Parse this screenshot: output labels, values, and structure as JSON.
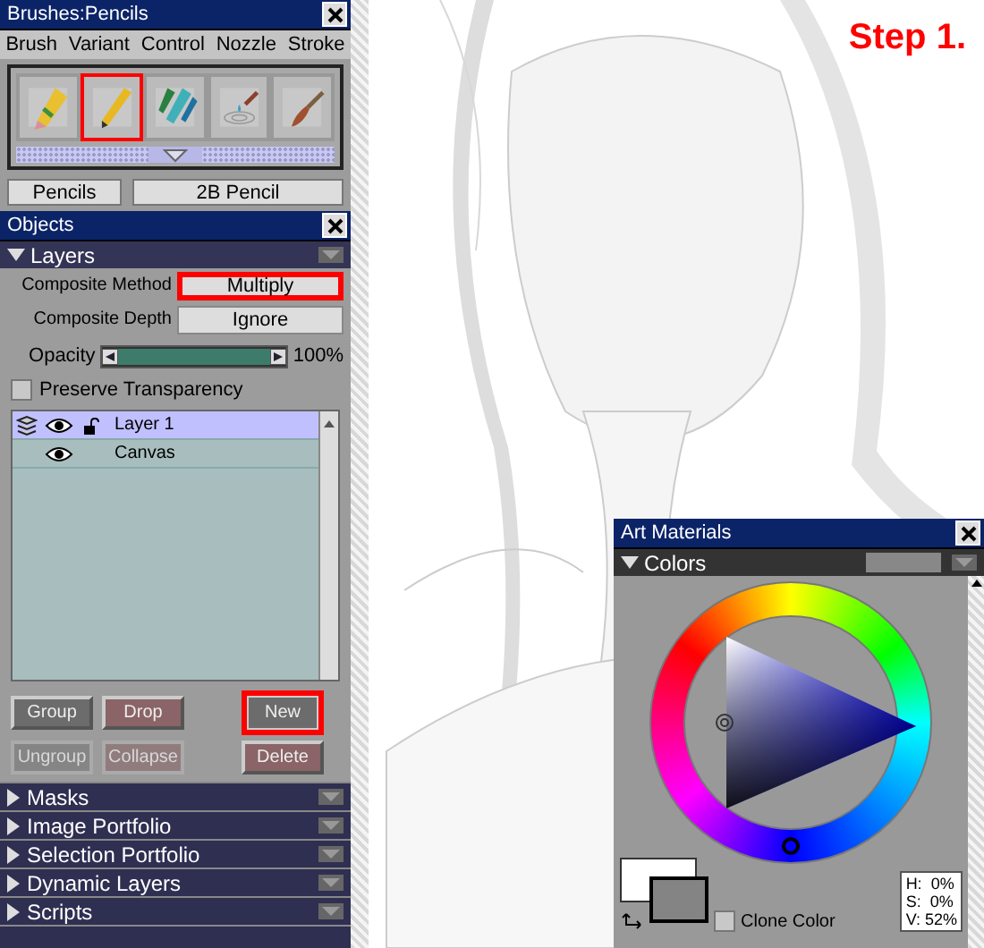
{
  "brushes_window": {
    "title": "Brushes:Pencils",
    "menu": [
      "Brush",
      "Variant",
      "Control",
      "Nozzle",
      "Stroke"
    ],
    "brushes": [
      {
        "kind": "eraser",
        "selected": false
      },
      {
        "kind": "pencil",
        "selected": true
      },
      {
        "kind": "markers",
        "selected": false
      },
      {
        "kind": "water",
        "selected": false
      },
      {
        "kind": "brush",
        "selected": false
      }
    ],
    "category": "Pencils",
    "variant": "2B Pencil"
  },
  "objects_window": {
    "title": "Objects",
    "section": "Layers",
    "composite_method": {
      "label": "Composite Method",
      "value": "Multiply",
      "highlighted": true
    },
    "composite_depth": {
      "label": "Composite Depth",
      "value": "Ignore",
      "highlighted": false
    },
    "opacity": {
      "label": "Opacity",
      "level": 1,
      "reading": "100%"
    },
    "preserve_transparency": {
      "label": "Preserve Transparency",
      "checked": false
    },
    "layers": [
      {
        "kind": "layer",
        "name": "Layer 1",
        "selected": true
      },
      {
        "kind": "canvas",
        "name": "Canvas",
        "selected": false
      }
    ],
    "buttons": [
      {
        "label": "Group",
        "kind": "plain",
        "disabled": false,
        "highlighted": false
      },
      {
        "label": "Drop",
        "kind": "tinted",
        "disabled": false,
        "highlighted": false
      },
      {
        "label": "New",
        "kind": "plain",
        "disabled": false,
        "highlighted": true
      },
      {
        "label": "Ungroup",
        "kind": "plain",
        "disabled": true,
        "highlighted": false
      },
      {
        "label": "Collapse",
        "kind": "tinted",
        "disabled": true,
        "highlighted": false
      },
      {
        "label": "Delete",
        "kind": "tinted",
        "disabled": false,
        "highlighted": false
      }
    ],
    "sections": [
      "Masks",
      "Image Portfolio",
      "Selection Portfolio",
      "Dynamic Layers",
      "Scripts"
    ]
  },
  "canvas": {
    "step_label": "Step 1."
  },
  "art_materials": {
    "title": "Art Materials",
    "section": "Colors",
    "readout": [
      "H:  0%",
      "S:  0%",
      "V: 52%"
    ],
    "clone_color": {
      "label": "Clone Color",
      "checked": false
    }
  }
}
